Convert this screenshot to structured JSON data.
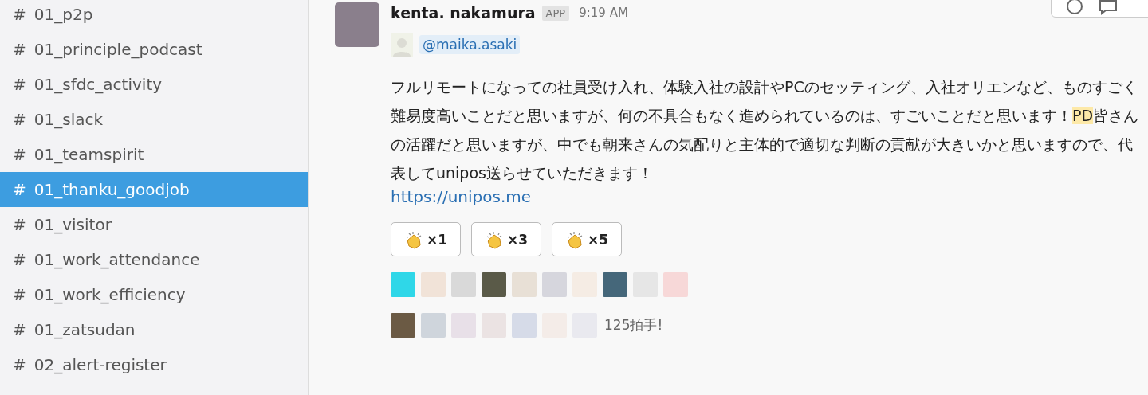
{
  "sidebar": {
    "channels": [
      {
        "prefix": "#",
        "name": "01_p2p",
        "selected": false
      },
      {
        "prefix": "#",
        "name": "01_principle_podcast",
        "selected": false
      },
      {
        "prefix": "#",
        "name": "01_sfdc_activity",
        "selected": false
      },
      {
        "prefix": "#",
        "name": "01_slack",
        "selected": false
      },
      {
        "prefix": "#",
        "name": "01_teamspirit",
        "selected": false
      },
      {
        "prefix": "#",
        "name": "01_thanku_goodjob",
        "selected": true
      },
      {
        "prefix": "#",
        "name": "01_visitor",
        "selected": false
      },
      {
        "prefix": "#",
        "name": "01_work_attendance",
        "selected": false
      },
      {
        "prefix": "#",
        "name": "01_work_efficiency",
        "selected": false
      },
      {
        "prefix": "#",
        "name": "01_zatsudan",
        "selected": false
      },
      {
        "prefix": "#",
        "name": "02_alert-register",
        "selected": false
      }
    ]
  },
  "message": {
    "author": "kenta. nakamura",
    "badge": "APP",
    "time": "9:19 AM",
    "mention": "@maika.asaki",
    "body": [
      {
        "text": "フルリモートになっての社員受け入れ、体験入社の設計やPCのセッティング、入社オリエンなど、ものすごく難易度高いことだと思いますが、何の不具合もなく進められているのは、すごいことだと思います！",
        "highlighted": false
      },
      {
        "text": "PD",
        "highlighted": true
      },
      {
        "text": "皆さんの活躍だと思いますが、中でも朝来さんの気配りと主体的で適切な判断の貢献が大きいかと思いますので、代表してunipos送らせていただきます！",
        "highlighted": false
      }
    ],
    "link": "https://unipos.me",
    "buttons": [
      {
        "label": "×1"
      },
      {
        "label": "×3"
      },
      {
        "label": "×5"
      }
    ],
    "clap_count": "125拍手!"
  }
}
